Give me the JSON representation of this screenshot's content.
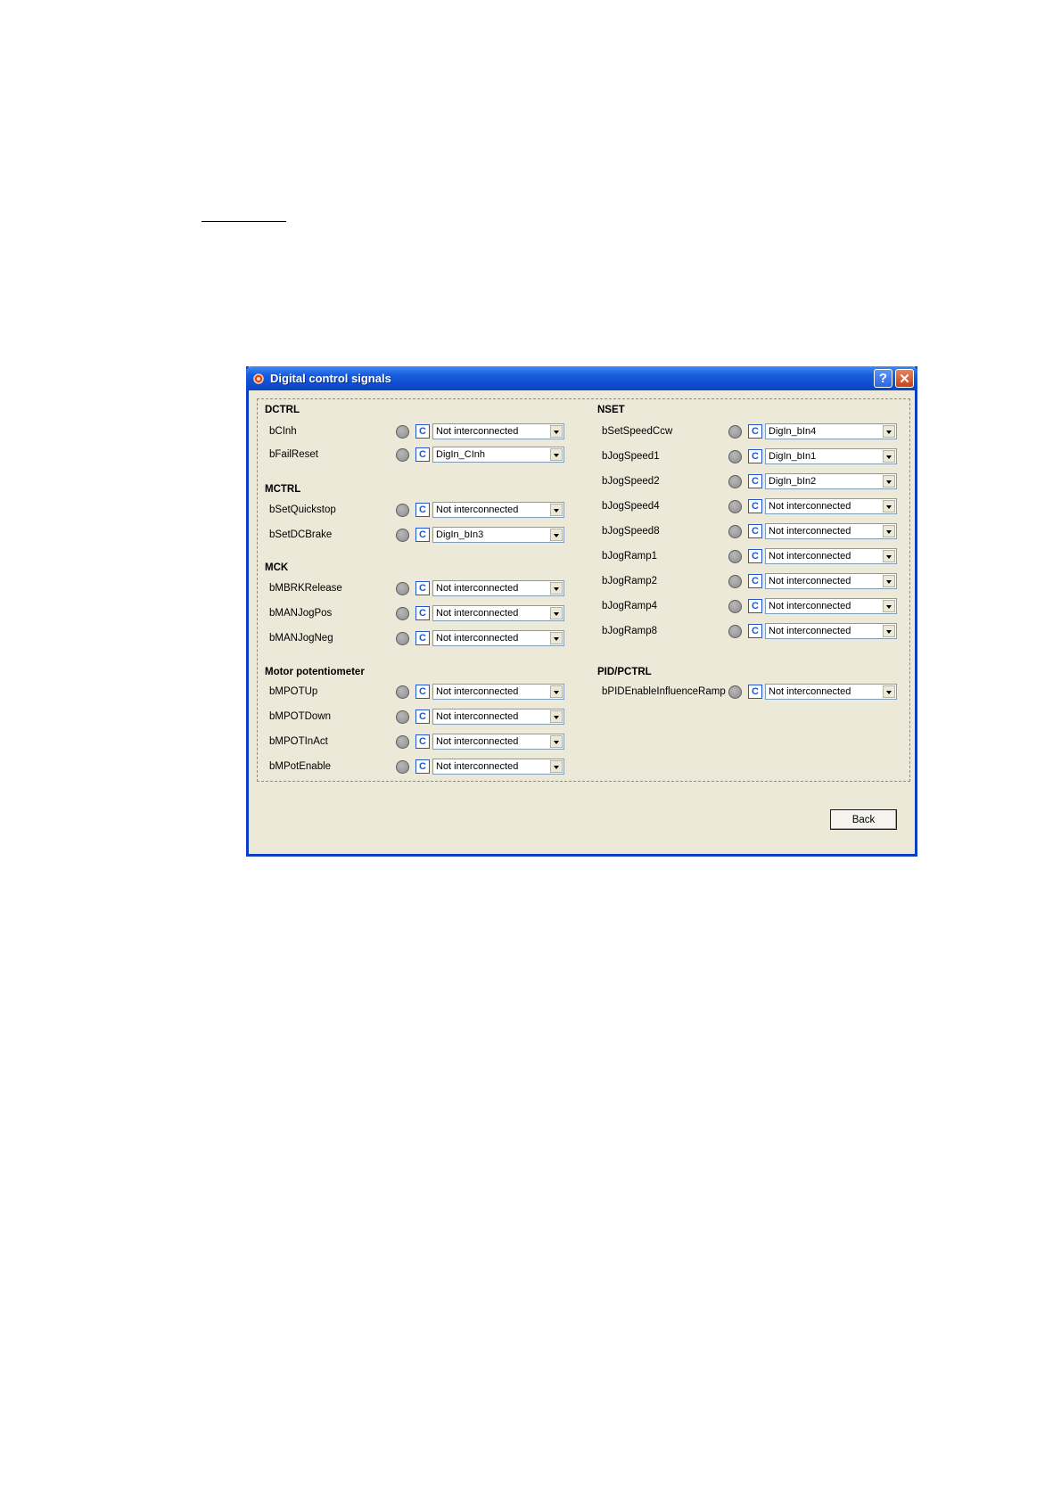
{
  "window": {
    "title": "Digital control signals",
    "help_label": "?",
    "close_label": "✕",
    "back_label": "Back"
  },
  "c_label": "C",
  "left_sections": [
    {
      "title": "DCTRL",
      "rows": [
        {
          "signal": "bCInh",
          "value": "Not interconnected"
        },
        {
          "signal": "bFailReset",
          "value": "DigIn_CInh"
        }
      ]
    },
    {
      "title": "MCTRL",
      "rows": [
        {
          "signal": "bSetQuickstop",
          "value": "Not interconnected"
        },
        {
          "signal": "bSetDCBrake",
          "value": "DigIn_bIn3"
        }
      ]
    },
    {
      "title": "MCK",
      "rows": [
        {
          "signal": "bMBRKRelease",
          "value": "Not interconnected"
        },
        {
          "signal": "bMANJogPos",
          "value": "Not interconnected"
        },
        {
          "signal": "bMANJogNeg",
          "value": "Not interconnected"
        }
      ]
    },
    {
      "title": "Motor potentiometer",
      "rows": [
        {
          "signal": "bMPOTUp",
          "value": "Not interconnected"
        },
        {
          "signal": "bMPOTDown",
          "value": "Not interconnected"
        },
        {
          "signal": "bMPOTInAct",
          "value": "Not interconnected"
        },
        {
          "signal": "bMPotEnable",
          "value": "Not interconnected"
        }
      ]
    }
  ],
  "right_sections": [
    {
      "title": "NSET",
      "rows": [
        {
          "signal": "bSetSpeedCcw",
          "value": "DigIn_bIn4"
        },
        {
          "signal": "bJogSpeed1",
          "value": "DigIn_bIn1"
        },
        {
          "signal": "bJogSpeed2",
          "value": "DigIn_bIn2"
        },
        {
          "signal": "bJogSpeed4",
          "value": "Not interconnected"
        },
        {
          "signal": "bJogSpeed8",
          "value": "Not interconnected"
        },
        {
          "signal": "bJogRamp1",
          "value": "Not interconnected"
        },
        {
          "signal": "bJogRamp2",
          "value": "Not interconnected"
        },
        {
          "signal": "bJogRamp4",
          "value": "Not interconnected"
        },
        {
          "signal": "bJogRamp8",
          "value": "Not interconnected"
        }
      ]
    },
    {
      "title": "PID/PCTRL",
      "rows": [
        {
          "signal": "bPIDEnableInfluenceRamp",
          "value": "Not interconnected"
        }
      ]
    }
  ]
}
